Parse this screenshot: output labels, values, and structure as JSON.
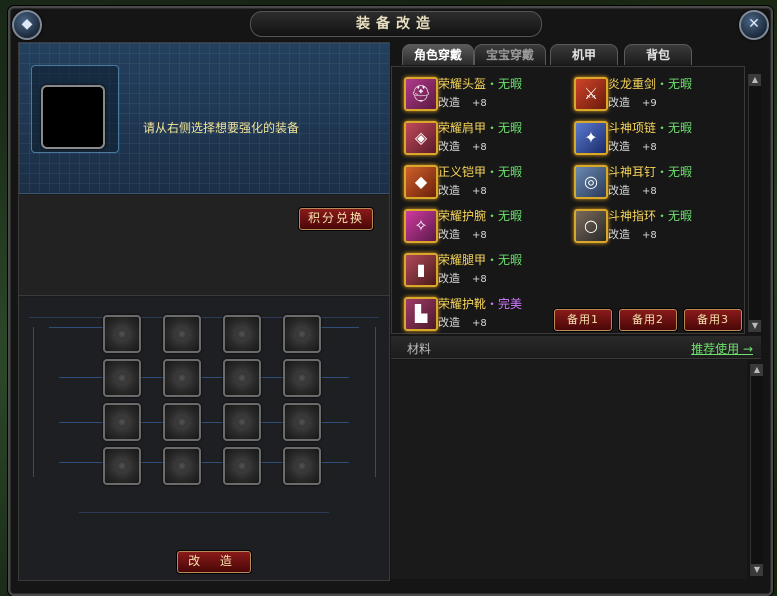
{
  "window": {
    "title": "装备改造"
  },
  "left_panel": {
    "prompt": "请从右侧选择想要强化的装备",
    "exchange_label": "积分兑换",
    "reform_label": "改 造"
  },
  "tabs": [
    {
      "label": "角色穿戴",
      "active": true
    },
    {
      "label": "宝宝穿戴",
      "active": false
    },
    {
      "label": "机甲",
      "active": false
    },
    {
      "label": "背包",
      "active": false
    }
  ],
  "items": [
    {
      "name": "荣耀头盔",
      "quality": "・无暇",
      "action": "改造",
      "level": "+8"
    },
    {
      "name": "炎龙重剑",
      "quality": "・无暇",
      "action": "改造",
      "level": "+9"
    },
    {
      "name": "荣耀肩甲",
      "quality": "・无暇",
      "action": "改造",
      "level": "+8"
    },
    {
      "name": "斗神项链",
      "quality": "・无暇",
      "action": "改造",
      "level": "+8"
    },
    {
      "name": "正义铠甲",
      "quality": "・无暇",
      "action": "改造",
      "level": "+8"
    },
    {
      "name": "斗神耳钉",
      "quality": "・无暇",
      "action": "改造",
      "level": "+8"
    },
    {
      "name": "荣耀护腕",
      "quality": "・无暇",
      "action": "改造",
      "level": "+8"
    },
    {
      "name": "斗神指环",
      "quality": "・无暇",
      "action": "改造",
      "level": "+8"
    },
    {
      "name": "荣耀腿甲",
      "quality": "・无暇",
      "action": "改造",
      "level": "+8"
    },
    {
      "name": "荣耀护靴",
      "quality": "・完美",
      "action": "改造",
      "level": "+8"
    }
  ],
  "spare_buttons": [
    "备用1",
    "备用2",
    "备用3"
  ],
  "materials": {
    "label": "材料",
    "recommend_label": "推荐使用 →"
  },
  "icons": {
    "scroll_up": "▲",
    "scroll_down": "▼",
    "close": "✕",
    "emblem": "◆"
  },
  "colors": {
    "item_name": "#f6d45b",
    "quality_flawless": "#6ee06e",
    "quality_perfect": "#d27aff"
  }
}
